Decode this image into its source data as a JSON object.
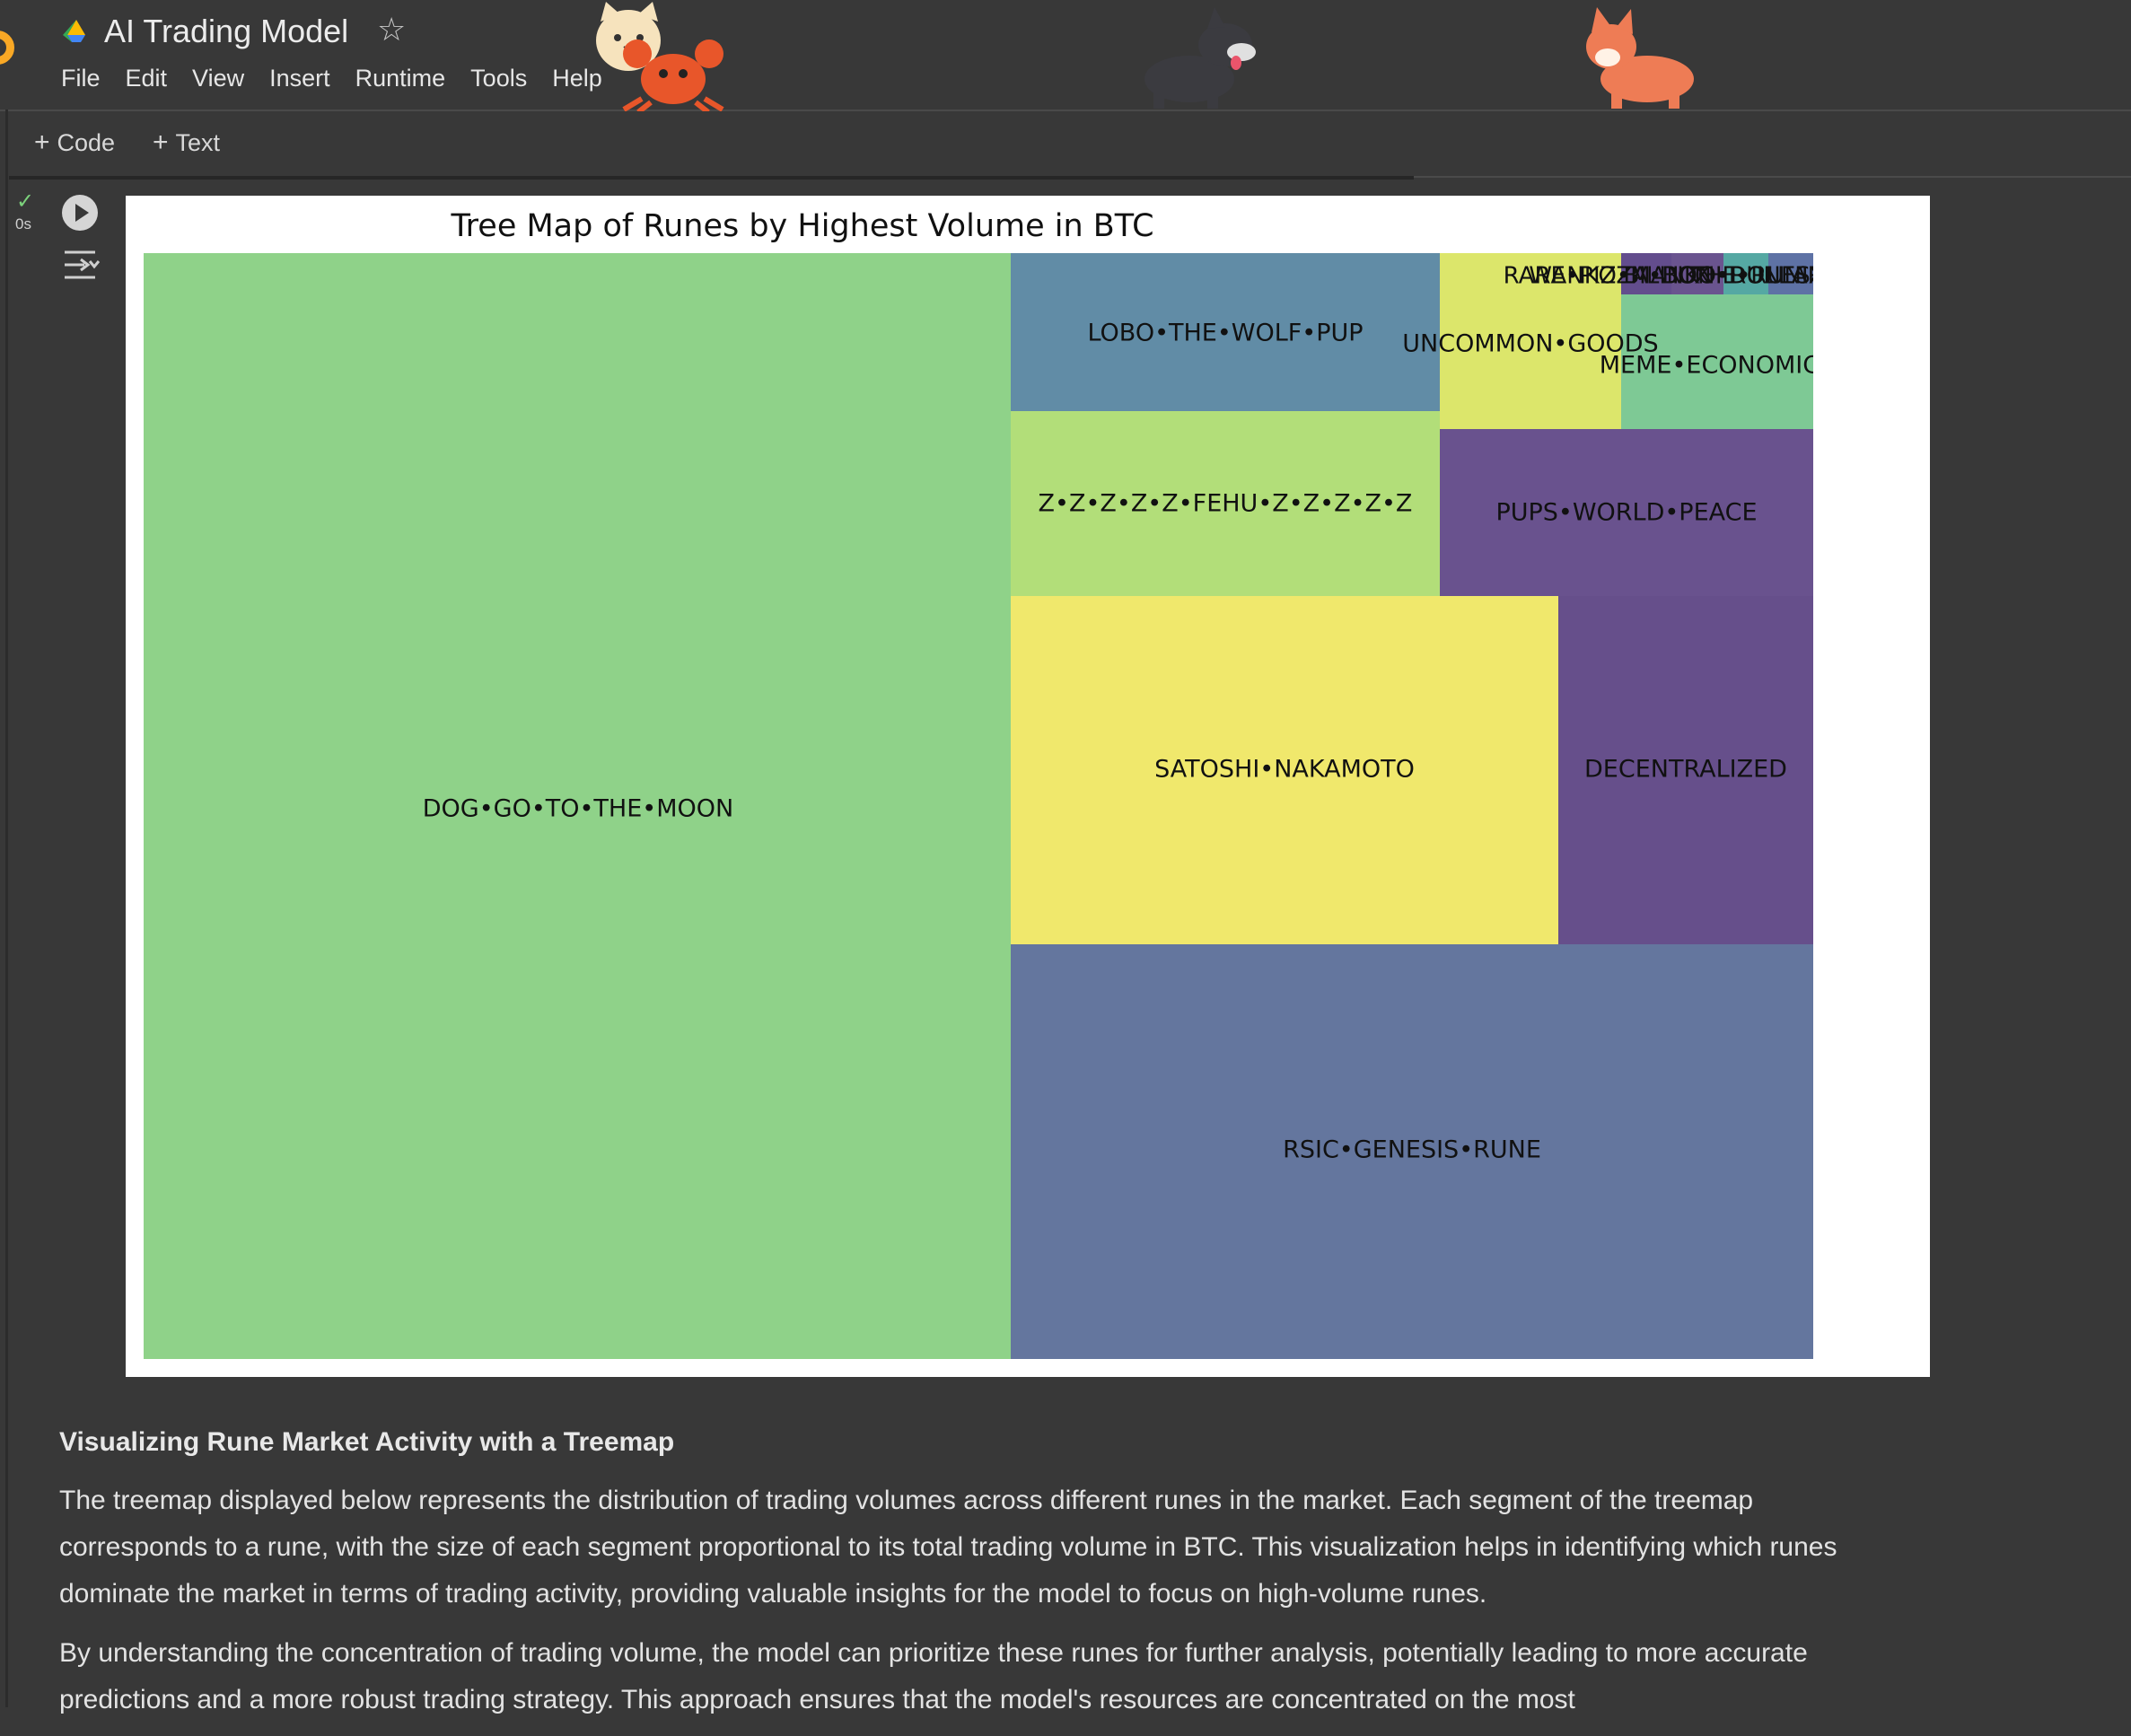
{
  "app": {
    "title": "AI Trading Model",
    "icons": {
      "logo": "colab-logo",
      "drive": "google-drive-icon",
      "star": "star-outline-icon"
    }
  },
  "menu": [
    "File",
    "Edit",
    "View",
    "Insert",
    "Runtime",
    "Tools",
    "Help"
  ],
  "toolbar": {
    "code_label": "Code",
    "text_label": "Text"
  },
  "cell": {
    "exec_time": "0s",
    "status": "completed",
    "icons": {
      "run": "play-circle-icon",
      "output": "output-toggle-icon",
      "status": "check-icon"
    }
  },
  "chart_data": {
    "type": "treemap",
    "title": "Tree Map of Runes by Highest Volume in BTC",
    "colormap": "viridis",
    "items": [
      {
        "label": "DOG•GO•TO•THE•MOON",
        "color": "#8fd289"
      },
      {
        "label": "RSIC•GENESIS•RUNE",
        "color": "#64769e"
      },
      {
        "label": "SATOSHI•NAKAMOTO",
        "color": "#f0e86c"
      },
      {
        "label": "DECENTRALIZED",
        "color": "#664f8b"
      },
      {
        "label": "Z•Z•Z•Z•Z•FEHU•Z•Z•Z•Z•Z",
        "color": "#b2de79"
      },
      {
        "label": "PUPS•WORLD•PEACE",
        "color": "#69528e"
      },
      {
        "label": "LOBO•THE•WOLF•PUP",
        "color": "#618ca6"
      },
      {
        "label": "UNCOMMON•GOODS",
        "color": "#dce66b"
      },
      {
        "label": "MEME•ECONOMICS",
        "color": "#7ec995"
      },
      {
        "label": "RARE•PIZZA•BOX",
        "color": "#634d8d"
      },
      {
        "label": "WANKO•MANKO•RUNES",
        "color": "#6a548f"
      },
      {
        "label": "BILLION•DOLLAR",
        "color": "#55a8a3"
      },
      {
        "label": "THE•RUNIX•TOKEN",
        "color": "#5e72a5"
      }
    ]
  },
  "markdown": {
    "heading": "Visualizing Rune Market Activity with a Treemap",
    "paragraphs": [
      "The treemap displayed below represents the distribution of trading volumes across different runes in the market. Each segment of the treemap corresponds to a rune, with the size of each segment proportional to its total trading volume in BTC. This visualization helps in identifying which runes dominate the market in terms of trading activity, providing valuable insights for the model to focus on high-volume runes.",
      "By understanding the concentration of trading volume, the model can prioritize these runes for further analysis, potentially leading to more accurate predictions and a more robust trading strategy. This approach ensures that the model's resources are concentrated on the most"
    ]
  },
  "decorations": [
    "cat-sticker",
    "crab-sticker",
    "black-dog-sticker",
    "corgi-sticker"
  ]
}
